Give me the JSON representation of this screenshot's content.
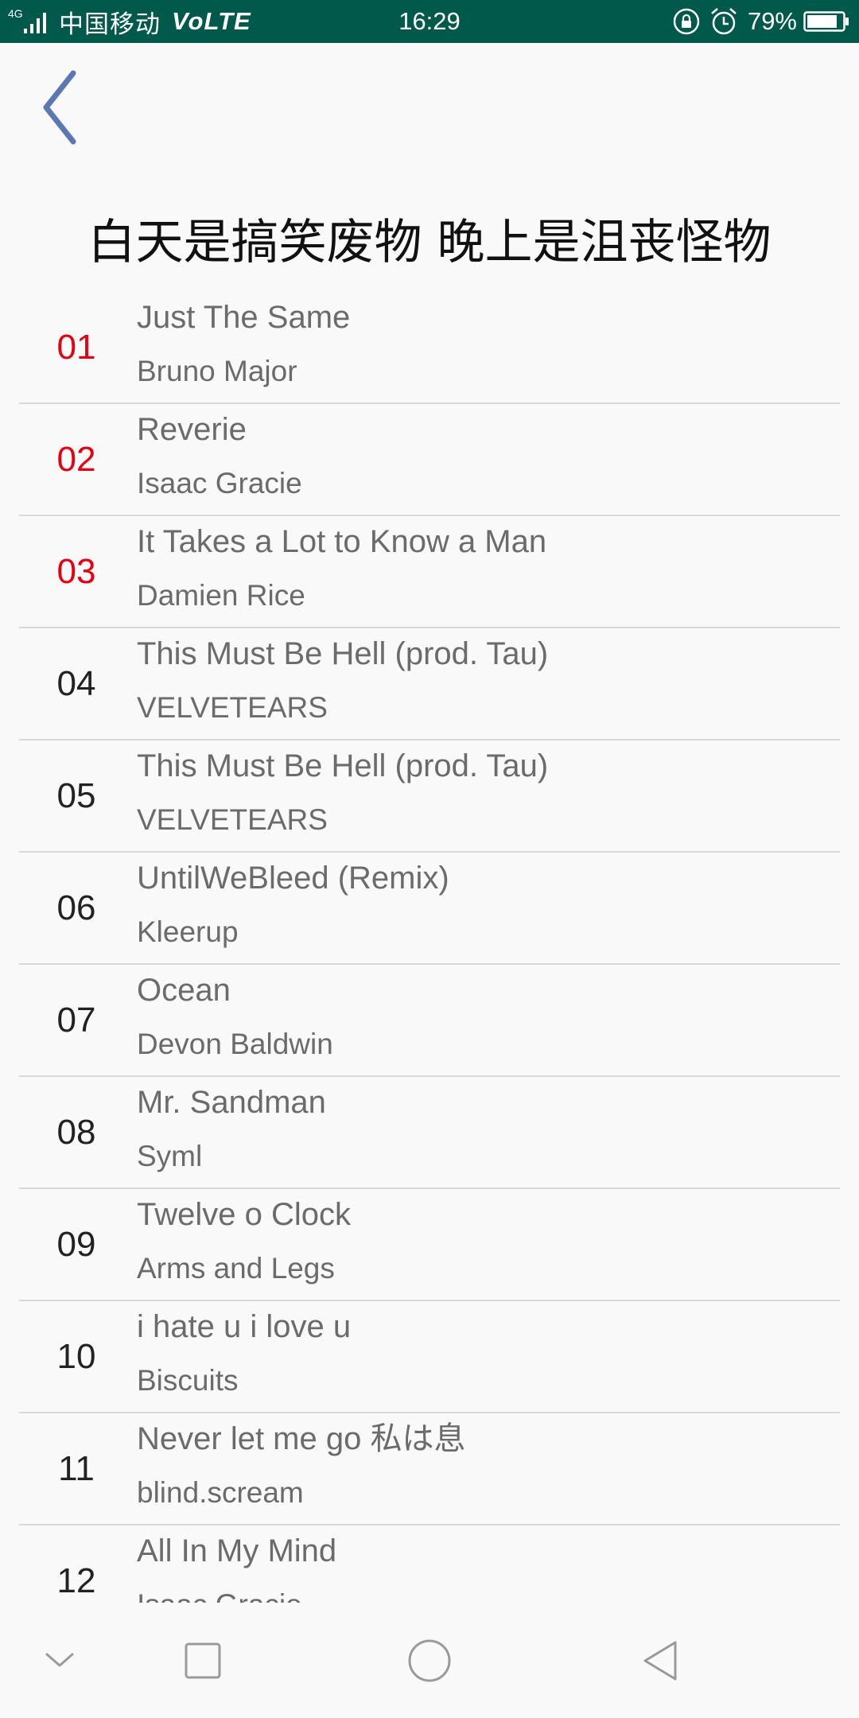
{
  "status_bar": {
    "network": "4G",
    "carrier": "中国移动",
    "volte": "VoLTE",
    "time": "16:29",
    "battery_percent": "79%",
    "icons": [
      "signal-icon",
      "lock-rotation-icon",
      "alarm-icon",
      "battery-icon"
    ],
    "background_color": "#00594b"
  },
  "header": {
    "back_icon": "chevron-left-icon",
    "back_color": "#5b78b4"
  },
  "playlist": {
    "title": "白天是搞笑废物  晚上是沮丧怪物",
    "highlight_color": "#e60012",
    "songs": [
      {
        "index": "01",
        "title": "Just The Same",
        "artist": "Bruno Major",
        "highlighted": true
      },
      {
        "index": "02",
        "title": "Reverie",
        "artist": "Isaac Gracie",
        "highlighted": true
      },
      {
        "index": "03",
        "title": "It Takes a Lot to Know a Man",
        "artist": "Damien Rice",
        "highlighted": true
      },
      {
        "index": "04",
        "title": "This Must Be Hell (prod. Tau)",
        "artist": "VELVETEARS",
        "highlighted": false
      },
      {
        "index": "05",
        "title": "This Must Be Hell (prod. Tau)",
        "artist": "VELVETEARS",
        "highlighted": false
      },
      {
        "index": "06",
        "title": "UntilWeBleed (Remix)",
        "artist": "Kleerup",
        "highlighted": false
      },
      {
        "index": "07",
        "title": "Ocean",
        "artist": "Devon Baldwin",
        "highlighted": false
      },
      {
        "index": "08",
        "title": "Mr. Sandman",
        "artist": "Syml",
        "highlighted": false
      },
      {
        "index": "09",
        "title": "Twelve o Clock",
        "artist": "Arms and Legs",
        "highlighted": false
      },
      {
        "index": "10",
        "title": "i hate u i love u",
        "artist": "Biscuits",
        "highlighted": false
      },
      {
        "index": "11",
        "title": "Never let me go 私は息",
        "artist": "blind.scream",
        "highlighted": false
      },
      {
        "index": "12",
        "title": "All In My Mind",
        "artist": "Isaac Gracie",
        "highlighted": false
      }
    ]
  },
  "nav_bar": {
    "buttons": [
      "hide-nav-icon",
      "recents-icon",
      "home-icon",
      "back-icon"
    ]
  }
}
